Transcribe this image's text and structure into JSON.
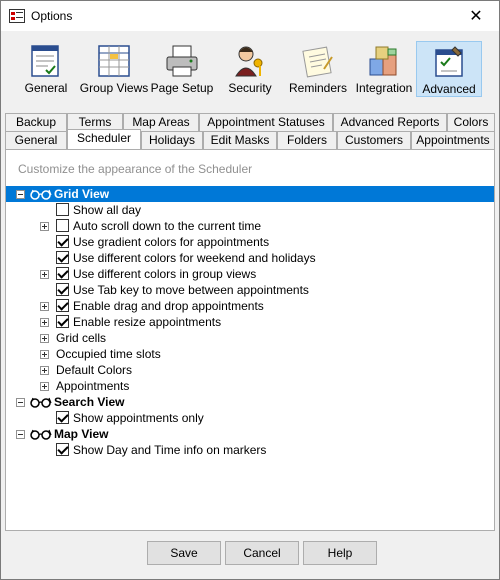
{
  "window": {
    "title": "Options",
    "close_symbol": "✕"
  },
  "toolbar": {
    "items": [
      {
        "label": "General",
        "icon": "general-form-icon"
      },
      {
        "label": "Group Views",
        "icon": "group-views-icon"
      },
      {
        "label": "Page Setup",
        "icon": "printer-icon"
      },
      {
        "label": "Security",
        "icon": "security-key-icon"
      },
      {
        "label": "Reminders",
        "icon": "reminders-icon"
      },
      {
        "label": "Integration",
        "icon": "integration-blocks-icon"
      },
      {
        "label": "Advanced",
        "icon": "advanced-tools-icon",
        "active": true
      }
    ]
  },
  "tabs": {
    "row_back": [
      "Backup",
      "Terms",
      "Map Areas",
      "Appointment Statuses",
      "Advanced Reports",
      "Colors"
    ],
    "row_front": [
      "General",
      "Scheduler",
      "Holidays",
      "Edit Masks",
      "Folders",
      "Customers",
      "Appointments"
    ],
    "selected": "Scheduler"
  },
  "panel": {
    "subtitle": "Customize the appearance of the Scheduler",
    "tree": [
      {
        "label": "Grid View",
        "type": "header"
      },
      {
        "label": "Show all day",
        "checked": false,
        "expandable": false
      },
      {
        "label": "Auto scroll down to the current time",
        "checked": false,
        "expandable": true
      },
      {
        "label": "Use gradient colors for appointments",
        "checked": true,
        "expandable": false
      },
      {
        "label": "Use different colors for weekend and holidays",
        "checked": true,
        "expandable": false
      },
      {
        "label": "Use different colors in group views",
        "checked": true,
        "expandable": true
      },
      {
        "label": "Use Tab key to move between appointments",
        "checked": true,
        "expandable": false
      },
      {
        "label": "Enable drag and drop appointments",
        "checked": true,
        "expandable": true
      },
      {
        "label": "Enable resize appointments",
        "checked": true,
        "expandable": true
      },
      {
        "label": "Grid cells",
        "expandable": true
      },
      {
        "label": "Occupied time slots",
        "expandable": true
      },
      {
        "label": "Default Colors",
        "expandable": true
      },
      {
        "label": "Appointments",
        "expandable": true
      },
      {
        "label": "Search View",
        "type": "header"
      },
      {
        "label": "Show appointments only",
        "checked": true,
        "expandable": false
      },
      {
        "label": "Map View",
        "type": "header"
      },
      {
        "label": "Show Day and Time info on markers",
        "checked": true,
        "expandable": false
      }
    ]
  },
  "buttons": {
    "save": "Save",
    "cancel": "Cancel",
    "help": "Help"
  },
  "colors": {
    "selection": "#0078d7",
    "subtitle": "#909090"
  }
}
